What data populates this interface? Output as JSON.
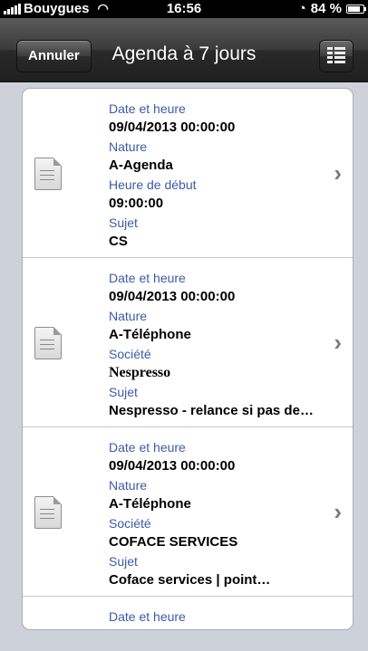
{
  "status_bar": {
    "carrier": "Bouygues",
    "time": "16:56",
    "battery": "84 %",
    "battery_level": 0.84
  },
  "nav": {
    "cancel_label": "Annuler",
    "title": "Agenda à 7 jours",
    "list_icon": "list-view-icon"
  },
  "items": [
    {
      "fields": [
        {
          "label": "Date et heure",
          "value": "09/04/2013 00:00:00"
        },
        {
          "label": "Nature",
          "value": "A-Agenda"
        },
        {
          "label": "Heure de début",
          "value": "09:00:00"
        },
        {
          "label": "Sujet",
          "value": "CS"
        }
      ]
    },
    {
      "fields": [
        {
          "label": "Date et heure",
          "value": "09/04/2013 00:00:00"
        },
        {
          "label": "Nature",
          "value": "A-Téléphone"
        },
        {
          "label": "Société",
          "value": "Nespresso"
        },
        {
          "label": "Sujet",
          "value": "Nespresso - relance si pas de…"
        }
      ]
    },
    {
      "fields": [
        {
          "label": "Date et heure",
          "value": "09/04/2013 00:00:00"
        },
        {
          "label": "Nature",
          "value": "A-Téléphone"
        },
        {
          "label": "Société",
          "value": "COFACE SERVICES"
        },
        {
          "label": "Sujet",
          "value": "Coface services | point…"
        }
      ]
    },
    {
      "fields": [
        {
          "label": "Date et heure",
          "value": ""
        }
      ]
    }
  ],
  "colors": {
    "label": "#3b5aa6",
    "background": "#cdd2da"
  }
}
